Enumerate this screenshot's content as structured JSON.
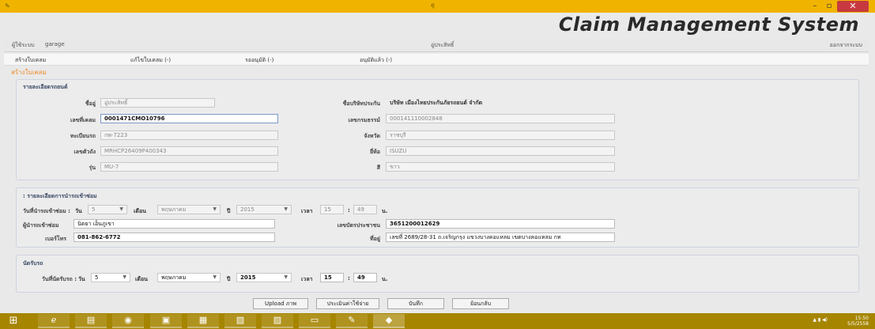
{
  "window": {
    "caption": "ę"
  },
  "app": {
    "title": "Claim Management System"
  },
  "userbar": {
    "user_label": "ผู้ใช้ระบบ",
    "user_value": "garage",
    "company": "อู่ประสิทธิ์",
    "logout": "ออกจากระบบ"
  },
  "menu": {
    "items": [
      "สร้างใบเคลม",
      "แก้ไขใบเคลม (-)",
      "รออนุมัติ (-)",
      "อนุมัติแล้ว (-)"
    ]
  },
  "section_title": "สร้างใบเคลม",
  "car": {
    "title": "รายละเอียดรถยนต์",
    "garage_label": "ชื่ออู่",
    "garage_value": "อู่ประสิทธิ์",
    "claim_no_label": "เลขที่เคลม",
    "claim_no_value": "0001471CMO10796",
    "plate_label": "ทะเบียนรถ",
    "plate_value": "กพ-7223",
    "chassis_label": "เลขตัวถัง",
    "chassis_value": "MRHCP26409P400343",
    "model_label": "รุ่น",
    "model_value": "MU-7",
    "insurer_label": "ชื่อบริษัทประกัน",
    "insurer_value": "บริษัท เมืองไทยประกันภัยรถยนต์ จำกัด",
    "policy_label": "เลขกรมธรรม์",
    "policy_value": "000141110002848",
    "province_label": "จังหวัด",
    "province_value": "ราชบุรี",
    "brand_label": "ยี่ห้อ",
    "brand_value": "ISUZU",
    "color_label": "สี",
    "color_value": "ขาว"
  },
  "repair": {
    "title": ": รายละเอียดการนำรถเข้าซ่อม",
    "date_label": "วันที่นำรถเข้าซ่อม :",
    "day_label": "วัน",
    "day_value": "5",
    "month_label": "เดือน",
    "month_value": "พฤษภาคม",
    "year_label": "ปี",
    "year_value": "2015",
    "time_label": "เวลา",
    "hour_value": "15",
    "minute_value": "49",
    "time_unit": "น.",
    "person_label": "ผู้นำรถเข้าซ่อม",
    "person_value": "นิตยา เอ็นภูเขา",
    "idcard_label": "เลขบัตรประชาชน",
    "idcard_value": "3651200012629",
    "phone_label": "เบอร์โทร",
    "phone_value": "081-862-6772",
    "address_label": "ที่อยู่",
    "address_value": "เลขที่ 2689/28-31 ถ.เจริญกรุง แขวงบางคอแหลม เขตบางคอแหลม กท"
  },
  "appointment": {
    "title": "นัดรับรถ",
    "date_label": "วันที่นัดรับรถ :",
    "day_label": "วัน",
    "day_value": "5",
    "month_label": "เดือน",
    "month_value": "พฤษภาคม",
    "year_label": "ปี",
    "year_value": "2015",
    "time_label": "เวลา",
    "hour_value": "15",
    "minute_value": "49",
    "time_unit": "น."
  },
  "buttons": {
    "upload": "Upload ภาพ",
    "estimate": "ประเมินค่าใช้จ่าย",
    "save": "บันทึก",
    "back": "ย้อนกลับ"
  },
  "taskbar": {
    "time": "15:50",
    "date": "5/5/2558"
  },
  "colors": {
    "titlebar": "#f0b400",
    "taskbar": "#a68500",
    "close": "#c7393f",
    "section_title": "#f08a2a"
  }
}
